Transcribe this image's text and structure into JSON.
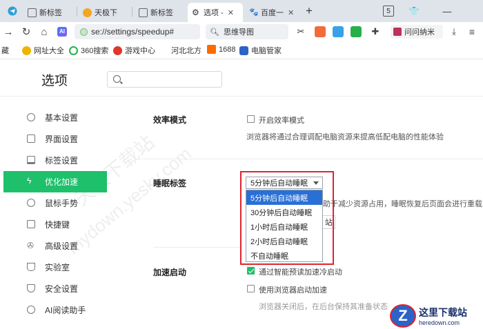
{
  "tabs": [
    {
      "title": "新标签",
      "icon": "page-icon",
      "active": false
    },
    {
      "title": "天极下",
      "icon": "tianji-icon",
      "active": false
    },
    {
      "title": "新标签",
      "icon": "page-icon",
      "active": false
    },
    {
      "title": "选项 - ",
      "icon": "gear-icon",
      "active": true
    },
    {
      "title": "百度一",
      "icon": "baidu-icon",
      "active": false
    }
  ],
  "tabbar": {
    "new_tab": "+",
    "badge": "5",
    "shirt": "👕",
    "minimize": "—"
  },
  "address": {
    "url": "se://settings/speedup#",
    "search_text": "思维导图",
    "user_label": "问问纳米"
  },
  "bookmarks": [
    {
      "label": "藏",
      "icon": "none"
    },
    {
      "label": "网址大全",
      "icon": "nav-icon"
    },
    {
      "label": "360搜索",
      "icon": "360-icon"
    },
    {
      "label": "游戏中心",
      "icon": "game-icon"
    },
    {
      "label": "河北北方",
      "icon": "none"
    },
    {
      "label": "1688",
      "icon": "1688-icon"
    },
    {
      "label": "电脑管家",
      "icon": "shield-icon"
    }
  ],
  "settings": {
    "title": "选项",
    "search_placeholder": "",
    "sidebar": [
      {
        "label": "基本设置",
        "icon": "gear-icon"
      },
      {
        "label": "界面设置",
        "icon": "window-icon"
      },
      {
        "label": "标签设置",
        "icon": "tab-icon"
      },
      {
        "label": "优化加速",
        "icon": "lightning-icon"
      },
      {
        "label": "鼠标手势",
        "icon": "mouse-icon"
      },
      {
        "label": "快捷键",
        "icon": "keyboard-icon"
      },
      {
        "label": "高级设置",
        "icon": "wrench-icon"
      },
      {
        "label": "实验室",
        "icon": "flask-icon"
      },
      {
        "label": "安全设置",
        "icon": "shield-icon"
      },
      {
        "label": "AI阅读助手",
        "icon": "ai-icon"
      }
    ],
    "active_index": 3,
    "efficiency": {
      "label": "效率模式",
      "checkbox_label": "开启效率模式",
      "checked": false,
      "description": "浏览器将通过合理调配电脑资源来提高低配电脑的性能体验"
    },
    "sleep": {
      "label": "睡眠标签",
      "selected": "5分钟后自动睡眠",
      "options": [
        "5分钟后自动睡眠",
        "30分钟后自动睡眠",
        "1小时后自动睡眠",
        "2小时后自动睡眠",
        "不自动睡眠"
      ],
      "description_tail": "助于减少资源占用，睡眠恢复后页面会进行重载",
      "button_fragment": "站"
    },
    "startup": {
      "label": "加速启动",
      "opt1": "通过智能预读加速冷启动",
      "opt1_checked": true,
      "opt2": "使用浏览器启动加速",
      "opt2_checked": false,
      "note": "浏览器关闭后，在后台保持其准备状态"
    }
  },
  "watermarks": [
    "天极下载站",
    "mydown.yesky.com"
  ],
  "logo": {
    "letter": "Z",
    "title": "这里下载站",
    "subtitle": "heredown.com"
  }
}
